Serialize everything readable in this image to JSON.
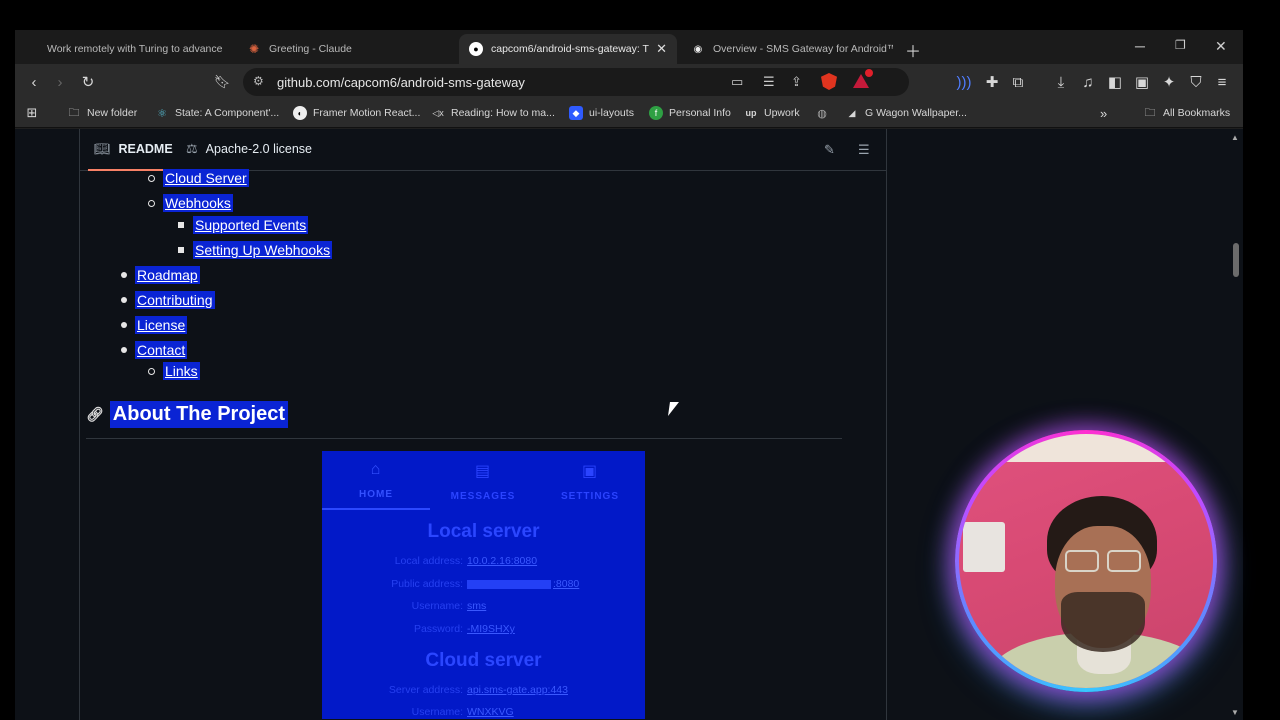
{
  "browser": {
    "tabs": [
      {
        "title": "Work remotely with Turing to advance",
        "icon": "turing-icon",
        "active": false
      },
      {
        "title": "Greeting - Claude",
        "icon": "claude-icon",
        "active": false
      },
      {
        "title": "capcom6/android-sms-gateway: T",
        "icon": "github-icon",
        "active": true
      },
      {
        "title": "Overview - SMS Gateway for Android™",
        "icon": "android-icon",
        "active": false
      }
    ],
    "url": "github.com/capcom6/android-sms-gateway",
    "bookmarks": [
      "New folder",
      "State: A Component'...",
      "Framer Motion React...",
      "Reading: How to ma...",
      "ui-layouts",
      "Personal Info",
      "Upwork",
      "",
      "G Wagon Wallpaper..."
    ],
    "all_bookmarks": "All Bookmarks",
    "brand_color": "#e0341f"
  },
  "readme": {
    "tabs": [
      {
        "label": "README",
        "icon": "book-icon"
      },
      {
        "label": "Apache-2.0 license",
        "icon": "scale-icon"
      }
    ],
    "toc": [
      {
        "label": "Cloud Server",
        "level": 2
      },
      {
        "label": "Webhooks",
        "level": 2
      },
      {
        "label": "Supported Events",
        "level": 3
      },
      {
        "label": "Setting Up Webhooks",
        "level": 3
      },
      {
        "label": "Roadmap",
        "level": 1
      },
      {
        "label": "Contributing",
        "level": 1
      },
      {
        "label": "License",
        "level": 1
      },
      {
        "label": "Contact",
        "level": 1
      },
      {
        "label": "Links",
        "level": 2
      }
    ],
    "heading": "About The Project",
    "selection_color": "#0a24d4"
  },
  "app_screenshot": {
    "nav": [
      "HOME",
      "MESSAGES",
      "SETTINGS"
    ],
    "local_title": "Local server",
    "local_fields": [
      {
        "k": "Local address:",
        "v": "10.0.2.16:8080"
      },
      {
        "k": "Public address:",
        "v": ":8080"
      },
      {
        "k": "Username:",
        "v": "sms"
      },
      {
        "k": "Password:",
        "v": "-MI9SHXy"
      }
    ],
    "cloud_title": "Cloud server",
    "cloud_fields": [
      {
        "k": "Server address:",
        "v": "api.sms-gate.app:443"
      },
      {
        "k": "Username:",
        "v": "WNXKVG"
      }
    ]
  }
}
